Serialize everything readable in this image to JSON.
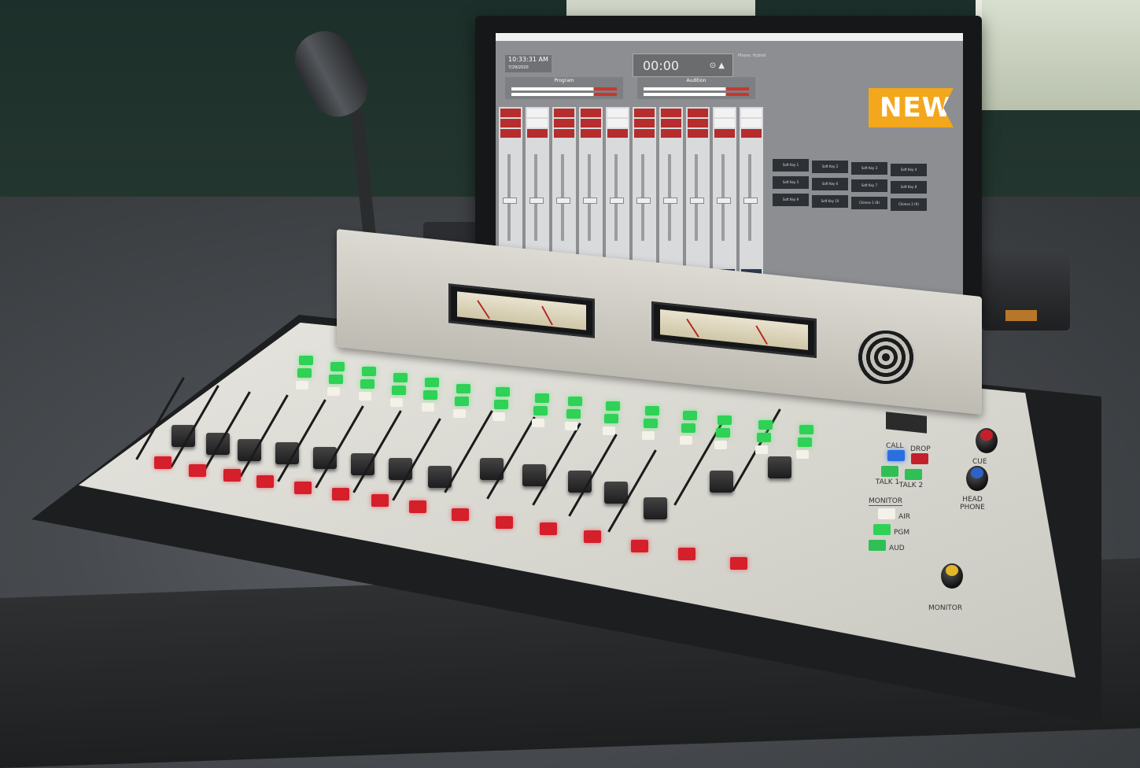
{
  "colors": {
    "badge": "#f3a71d",
    "wall": "#23342f",
    "console_panel": "#e0dfd8",
    "channel_button": "#d51f2b",
    "led_green": "#2fd156",
    "screen_bg": "#8c8e91"
  },
  "badge": {
    "text": "NEW"
  },
  "screen": {
    "clock_time": "10:33:31 AM",
    "clock_date": "7/29/2020",
    "timer": "00:00",
    "phone_label": "Phone: Hybrid",
    "buses": [
      {
        "label": "Program"
      },
      {
        "label": "Audition"
      }
    ],
    "soft_keys": [
      "Soft Key 1",
      "Soft Key 2",
      "Soft Key 3",
      "Soft Key 4",
      "Soft Key 5",
      "Soft Key 6",
      "Soft Key 7",
      "Soft Key 8",
      "Soft Key 9",
      "Soft Key 10",
      "Chimes 1 (B)",
      "Chimes 2 (R)"
    ]
  },
  "console": {
    "legends": [
      "PGM",
      "AUD",
      "CUE"
    ],
    "controls": {
      "call": "CALL",
      "drop": "DROP",
      "talk1": "TALK 1",
      "talk2": "TALK 2",
      "monitor_section": "MONITOR",
      "air": "AIR",
      "pgm": "PGM",
      "aud": "AUD",
      "cue_knob": "CUE",
      "headphone_knob": "HEAD PHONE",
      "monitor_knob": "MONITOR"
    },
    "icons": [
      "meter-bridge-speaker-icon",
      "vu-meter-icon",
      "fader-icon",
      "knob-icon"
    ]
  }
}
